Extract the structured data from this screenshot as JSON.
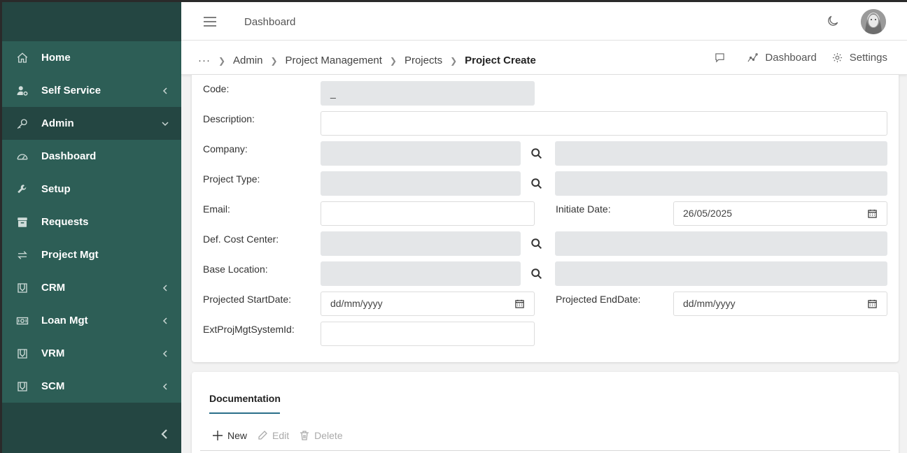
{
  "header": {
    "title": "Dashboard"
  },
  "sidebar": {
    "items": [
      {
        "label": "Home",
        "icon": "home-icon",
        "arrow": ""
      },
      {
        "label": "Self Service",
        "icon": "user-gear-icon",
        "arrow": "left"
      },
      {
        "label": "Admin",
        "icon": "key-icon",
        "arrow": "down"
      },
      {
        "label": "Dashboard",
        "icon": "gauge-icon",
        "arrow": ""
      },
      {
        "label": "Setup",
        "icon": "wrench-icon",
        "arrow": ""
      },
      {
        "label": "Requests",
        "icon": "archive-icon",
        "arrow": ""
      },
      {
        "label": "Project Mgt",
        "icon": "swap-icon",
        "arrow": ""
      },
      {
        "label": "CRM",
        "icon": "map-icon",
        "arrow": "left"
      },
      {
        "label": "Loan Mgt",
        "icon": "banknote-icon",
        "arrow": "left"
      },
      {
        "label": "VRM",
        "icon": "map-icon",
        "arrow": "left"
      },
      {
        "label": "SCM",
        "icon": "map-icon",
        "arrow": "left"
      }
    ]
  },
  "breadcrumb": {
    "ellipsis": "···",
    "items": [
      "Admin",
      "Project Management",
      "Projects"
    ],
    "current": "Project Create"
  },
  "crumb_actions": {
    "dashboard": "Dashboard",
    "settings": "Settings"
  },
  "form": {
    "code_label": "Code:",
    "code_value": "_",
    "description_label": "Description:",
    "company_label": "Company:",
    "project_type_label": "Project Type:",
    "email_label": "Email:",
    "initiate_date_label": "Initiate Date:",
    "initiate_date_value": "26/05/2025",
    "cost_center_label": "Def. Cost Center:",
    "base_location_label": "Base Location:",
    "start_date_label": "Projected StartDate:",
    "start_date_placeholder": "dd/mm/yyyy",
    "end_date_label": "Projected EndDate:",
    "end_date_placeholder": "dd/mm/yyyy",
    "ext_id_label": "ExtProjMgtSystemId:"
  },
  "documentation": {
    "tab": "Documentation",
    "new_label": "New",
    "edit_label": "Edit",
    "delete_label": "Delete"
  },
  "colors": {
    "sidebar": "#244642",
    "sidebar_highlight": "#2d5e56",
    "accent": "#2a6f89",
    "disabled_input": "#e4e6e8"
  }
}
